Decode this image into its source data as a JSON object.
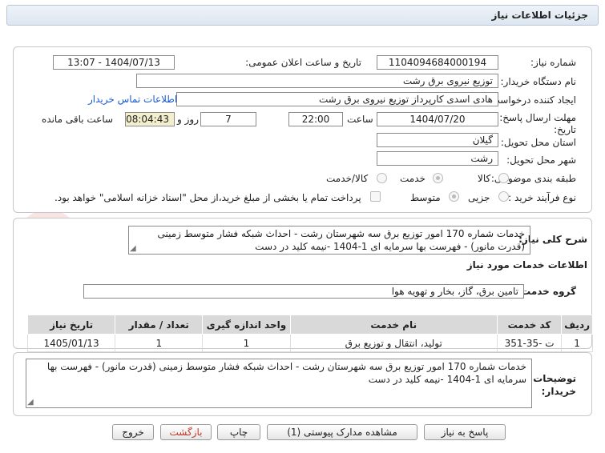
{
  "page_title": "جزئیات اطلاعات نیاز",
  "fields": {
    "need_number_label": "شماره نیاز:",
    "need_number": "1104094684000194",
    "announce_label": "تاریخ و ساعت اعلان عمومی:",
    "announce_value": "1404/07/13 - 13:07",
    "buyer_org_label": "نام دستگاه خریدار:",
    "buyer_org": "توزیع نیروی برق رشت",
    "creator_label": "ایجاد کننده درخواست:",
    "creator": "هادی  اسدی کارپرداز توزیع نیروی برق رشت",
    "contact_link": "اطلاعات تماس خریدار",
    "deadline_label_1": "مهلت ارسال پاسخ: تا",
    "deadline_label_2": "تاریخ:",
    "deadline_date": "1404/07/20",
    "time_label": "ساعت",
    "deadline_time": "22:00",
    "days_value": "7",
    "days_label": "روز و",
    "remaining_time": "08:04:43",
    "remaining_label": "ساعت باقی مانده",
    "province_label": "استان محل تحویل:",
    "province": "گیلان",
    "city_label": "شهر محل تحویل:",
    "city": "رشت",
    "category_label": "طبقه بندی موضوعی:",
    "category_options": [
      "کالا",
      "خدمت",
      "کالا/خدمت"
    ],
    "process_label": "نوع فرآیند خرید :",
    "process_options": [
      "جزیی",
      "متوسط"
    ],
    "payment_note": "پرداخت تمام یا بخشی از مبلغ خرید،از محل \"اسناد خزانه اسلامی\" خواهد بود."
  },
  "summary": {
    "label": "شرح کلی نیاز:",
    "text": "خدمات شماره 170 امور توزیع برق سه شهرستان رشت - احداث شبکه فشار متوسط زمینی (قدرت مانور)  - فهرست بها سرمایه ای 1-1404 -نیمه کلید در دست"
  },
  "services_title": "اطلاعات خدمات مورد نیاز",
  "service_group": {
    "label": "گروه خدمت:",
    "value": "تامین برق، گاز، بخار و تهویه هوا"
  },
  "table": {
    "headers": [
      "ردیف",
      "کد خدمت",
      "نام خدمت",
      "واحد اندازه گیری",
      "تعداد / مقدار",
      "تاریخ نیاز"
    ],
    "rows": [
      [
        "1",
        "ت -35-351",
        "تولید، انتقال و توزیع برق",
        "1",
        "1",
        "1405/01/13"
      ]
    ]
  },
  "buyer_notes": {
    "label_1": "توضیحات",
    "label_2": "خریدار:",
    "text": "خدمات شماره 170 امور توزیع برق سه شهرستان رشت - احداث شبکه فشار متوسط زمینی (قدرت مانور)  - فهرست بها سرمایه ای 1-1404 -نیمه کلید در دست"
  },
  "buttons": {
    "reply": "پاسخ به نیاز",
    "attachments": "مشاهده مدارک پیوستی (1)",
    "print": "چاپ",
    "back": "بازگشت",
    "exit": "خروج"
  },
  "watermark": "AriaTender.net",
  "colors": {
    "link": "#1a5bd6",
    "remaining_bg": "#f3efcc",
    "back_text": "#c0392b"
  }
}
